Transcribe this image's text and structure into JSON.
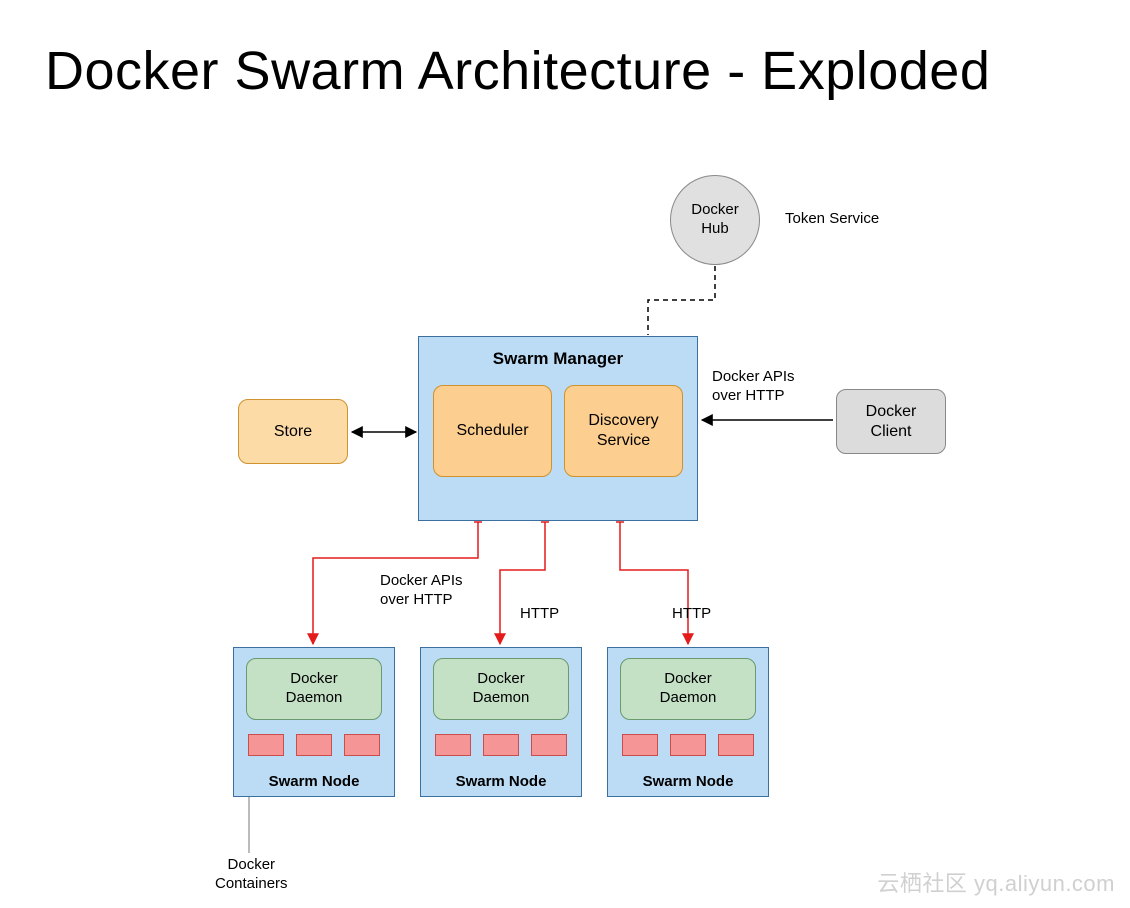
{
  "title": "Docker Swarm Architecture  - Exploded",
  "docker_hub": {
    "label": "Docker\nHub"
  },
  "token_service_label": "Token Service",
  "store": {
    "label": "Store"
  },
  "swarm_manager": {
    "title": "Swarm  Manager",
    "scheduler": "Scheduler",
    "discovery": "Discovery\nService"
  },
  "client_api_label": "Docker APIs\nover HTTP",
  "docker_client": {
    "label": "Docker\nClient"
  },
  "node_api_label_full": "Docker APIs\nover HTTP",
  "node_api_label_short_1": "HTTP",
  "node_api_label_short_2": "HTTP",
  "nodes": [
    {
      "daemon": "Docker\nDaemon",
      "title": "Swarm  Node"
    },
    {
      "daemon": "Docker\nDaemon",
      "title": "Swarm  Node"
    },
    {
      "daemon": "Docker\nDaemon",
      "title": "Swarm  Node"
    }
  ],
  "containers_label": "Docker\nContainers",
  "watermark": "云栖社区  yq.aliyun.com",
  "colors": {
    "blue_fill": "#bcdcf5",
    "blue_border": "#3b6fa0",
    "orange_fill": "#fcdba7",
    "orange_inner": "#fcce8f",
    "orange_border": "#d0922e",
    "green_fill": "#c4e1c6",
    "green_border": "#6a9a6d",
    "red_fill": "#f59595",
    "red_border": "#cc4d4d",
    "grey_fill": "#dcdcdc",
    "grey_border": "#888888",
    "arrow_red": "#e31b1b"
  }
}
